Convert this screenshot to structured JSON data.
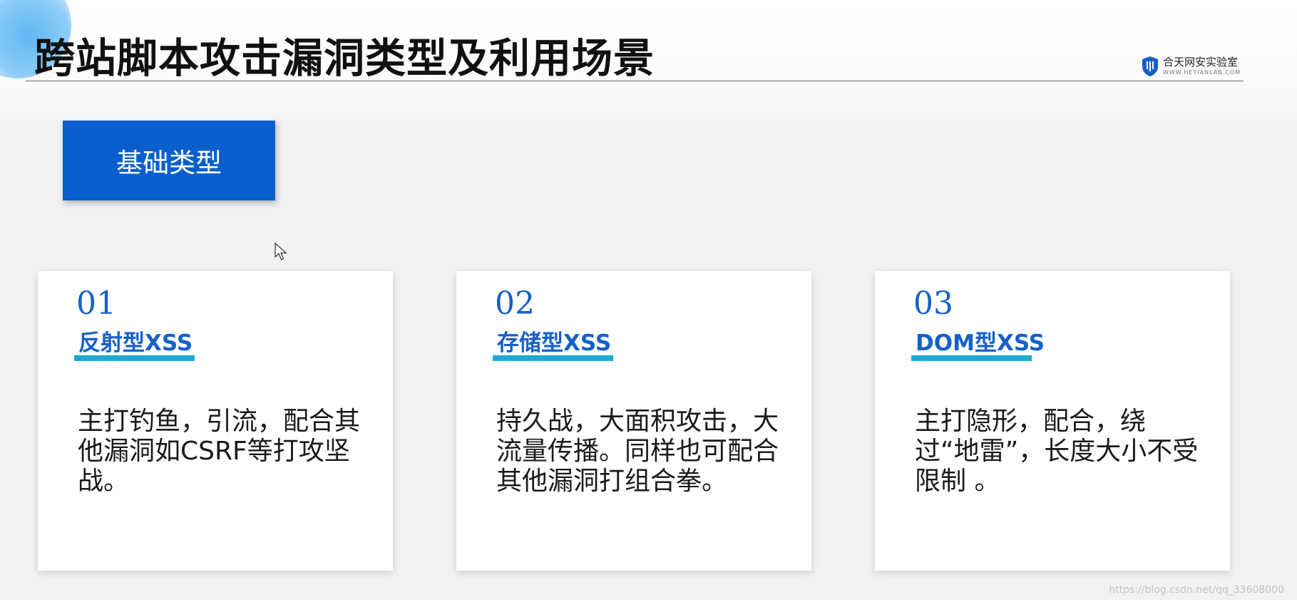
{
  "slide": {
    "title": "跨站脚本攻击漏洞类型及利用场景",
    "logo": {
      "name": "合天网安实验室",
      "url": "WWW.HETIANLAB.COM",
      "icon": "shield-icon"
    },
    "type_button": {
      "label": "基础类型"
    },
    "cards": [
      {
        "number": "01",
        "title": "反射型XSS",
        "body": "主打钓鱼，引流，配合其他漏洞如CSRF等打攻坚战。"
      },
      {
        "number": "02",
        "title": "存储型XSS",
        "body": "持久战，大面积攻击，大流量传播。同样也可配合其他漏洞打组合拳。"
      },
      {
        "number": "03",
        "title": "DOM型XSS",
        "body": "主打隐形，配合，绕过“地雷”，长度大小不受限制 。"
      }
    ],
    "watermark": "https://blog.csdn.net/qq_33608000"
  },
  "colors": {
    "accent_blue": "#0a5fcc",
    "title_blue": "#1560c8",
    "underline_cyan": "#1ea8d2"
  }
}
